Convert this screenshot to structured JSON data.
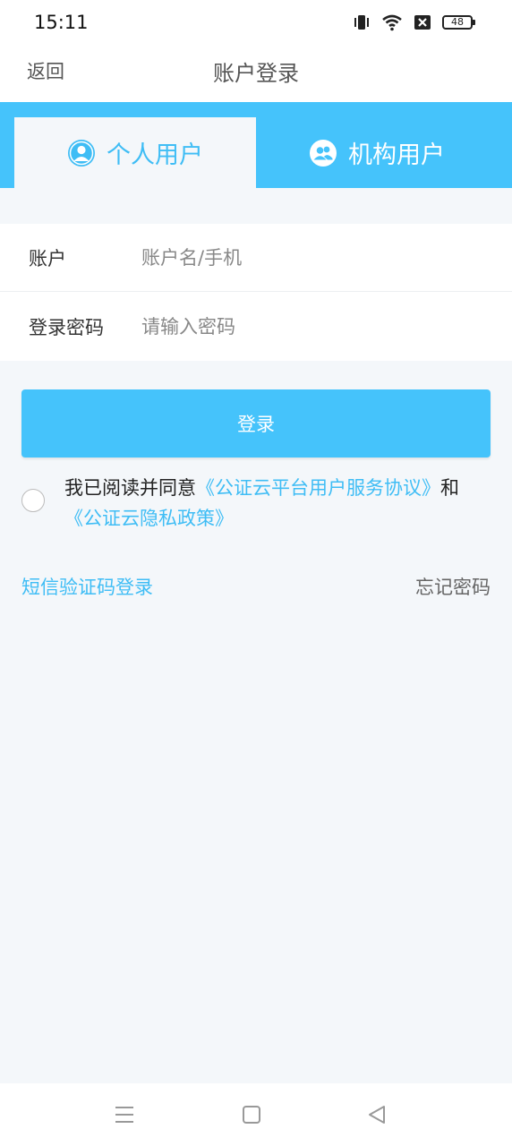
{
  "status": {
    "time": "15:11",
    "battery": "48",
    "icons": [
      "vibrate-icon",
      "wifi-icon",
      "sim-off-icon",
      "battery-icon"
    ]
  },
  "nav": {
    "back": "返回",
    "title": "账户登录"
  },
  "tabs": [
    {
      "label": "个人用户",
      "icon": "person-icon",
      "active": true
    },
    {
      "label": "机构用户",
      "icon": "group-icon",
      "active": false
    }
  ],
  "form": {
    "account_label": "账户",
    "account_placeholder": "账户名/手机",
    "password_label": "登录密码",
    "password_placeholder": "请输入密码"
  },
  "login_button": "登录",
  "agreement": {
    "prefix": "我已阅读并同意",
    "link1": "《公证云平台用户服务协议》",
    "and": "和",
    "link2": "《公证云隐私政策》",
    "checked": false
  },
  "links": {
    "sms_login": "短信验证码登录",
    "forgot_password": "忘记密码"
  },
  "colors": {
    "accent": "#45c3fb",
    "link": "#3fbdf5",
    "background": "#f4f7fa"
  },
  "system_nav": [
    "menu-icon",
    "home-icon",
    "back-icon"
  ]
}
